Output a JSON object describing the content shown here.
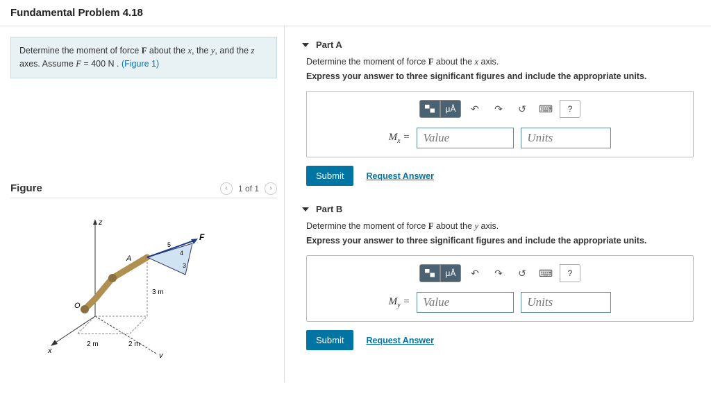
{
  "header": {
    "title": "Fundamental Problem 4.18"
  },
  "problem": {
    "text_before": "Determine the moment of force ",
    "F": "F",
    "text_mid1": " about the ",
    "x": "x",
    "text_comma": ", the ",
    "y": "y",
    "text_and": ", and the ",
    "z": "z",
    "text_axes": " axes. Assume ",
    "deflabel": "F",
    "eq": " = ",
    "defval": "400 N",
    "text_dot": " . ",
    "figlink": "(Figure 1)"
  },
  "figure": {
    "heading": "Figure",
    "pager": "1 of 1"
  },
  "partA": {
    "label": "Part A",
    "question_pre": "Determine the moment of force ",
    "question_F": "F",
    "question_mid": " about the ",
    "question_axis": "x",
    "question_post": " axis.",
    "instruction": "Express your answer to three significant figures and include the appropriate units.",
    "eq_label_base": "M",
    "eq_label_sub": "x",
    "eq_equals": " = ",
    "value_ph": "Value",
    "units_ph": "Units",
    "submit": "Submit",
    "request": "Request Answer",
    "tb_mu": "μÅ",
    "tb_q": "?"
  },
  "partB": {
    "label": "Part B",
    "question_pre": "Determine the moment of force ",
    "question_F": "F",
    "question_mid": " about the ",
    "question_axis": "y",
    "question_post": " axis.",
    "instruction": "Express your answer to three significant figures and include the appropriate units.",
    "eq_label_base": "M",
    "eq_label_sub": "y",
    "eq_equals": " = ",
    "value_ph": "Value",
    "units_ph": "Units",
    "submit": "Submit",
    "request": "Request Answer",
    "tb_mu": "μÅ",
    "tb_q": "?"
  },
  "diagram": {
    "axis_z": "z",
    "axis_x": "x",
    "axis_y": "y",
    "origin": "O",
    "pointA": "A",
    "forceF": "F",
    "dim_2m_a": "2 m",
    "dim_2m_b": "2 m",
    "dim_3m": "3 m",
    "ang5a": "5",
    "ang4": "4",
    "ang3": "3"
  }
}
